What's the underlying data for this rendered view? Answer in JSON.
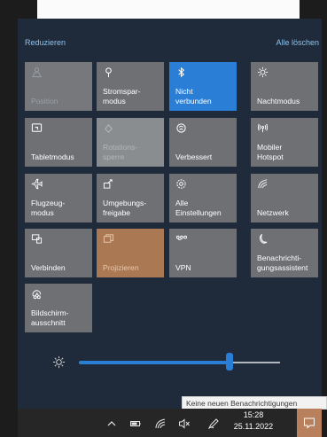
{
  "header": {
    "collapse_label": "Reduzieren",
    "clear_all_label": "Alle löschen"
  },
  "tiles": [
    {
      "label": "Position",
      "icon": "person-location-icon",
      "state": "disabled"
    },
    {
      "label": "Stromspar-\nmodus",
      "icon": "battery-saver-icon",
      "state": "off"
    },
    {
      "label": "Nicht\nverbunden",
      "icon": "bluetooth-icon",
      "state": "active"
    },
    {
      "label": "Nachtmodus",
      "icon": "brightness-icon",
      "state": "off"
    },
    {
      "label": "Tabletmodus",
      "icon": "tablet-mode-icon",
      "state": "off"
    },
    {
      "label": "Rotations-\nsperre",
      "icon": "rotation-lock-icon",
      "state": "disabled"
    },
    {
      "label": "Verbessert",
      "icon": "focus-assist-icon",
      "state": "off"
    },
    {
      "label": "Mobiler\nHotspot",
      "icon": "hotspot-icon",
      "state": "off"
    },
    {
      "label": "Flugzeug-\nmodus",
      "icon": "airplane-icon",
      "state": "off"
    },
    {
      "label": "Umgebungs-\nfreigabe",
      "icon": "nearby-sharing-icon",
      "state": "off"
    },
    {
      "label": "Alle\nEinstellungen",
      "icon": "settings-gear-icon",
      "state": "off"
    },
    {
      "label": "Netzwerk",
      "icon": "network-icon",
      "state": "off"
    },
    {
      "label": "Verbinden",
      "icon": "connect-icon",
      "state": "off"
    },
    {
      "label": "Projizieren",
      "icon": "project-icon",
      "state": "highlight"
    },
    {
      "label": "VPN",
      "icon": "vpn-icon",
      "state": "off"
    },
    {
      "label": "Benachrichti-\ngungsassistent",
      "icon": "moon-icon",
      "state": "off"
    },
    {
      "label": "Bildschirm-\nausschnitt",
      "icon": "screen-snip-icon",
      "state": "off"
    }
  ],
  "brightness": {
    "value": 0.75
  },
  "tooltip": {
    "text": "Keine neuen Benachrichtigungen"
  },
  "taskbar": {
    "icons": [
      "chevron-up-icon",
      "battery-icon",
      "wifi-icon",
      "volume-mute-icon",
      "pen-icon"
    ],
    "time": "15:28",
    "date": "25.11.2022"
  }
}
